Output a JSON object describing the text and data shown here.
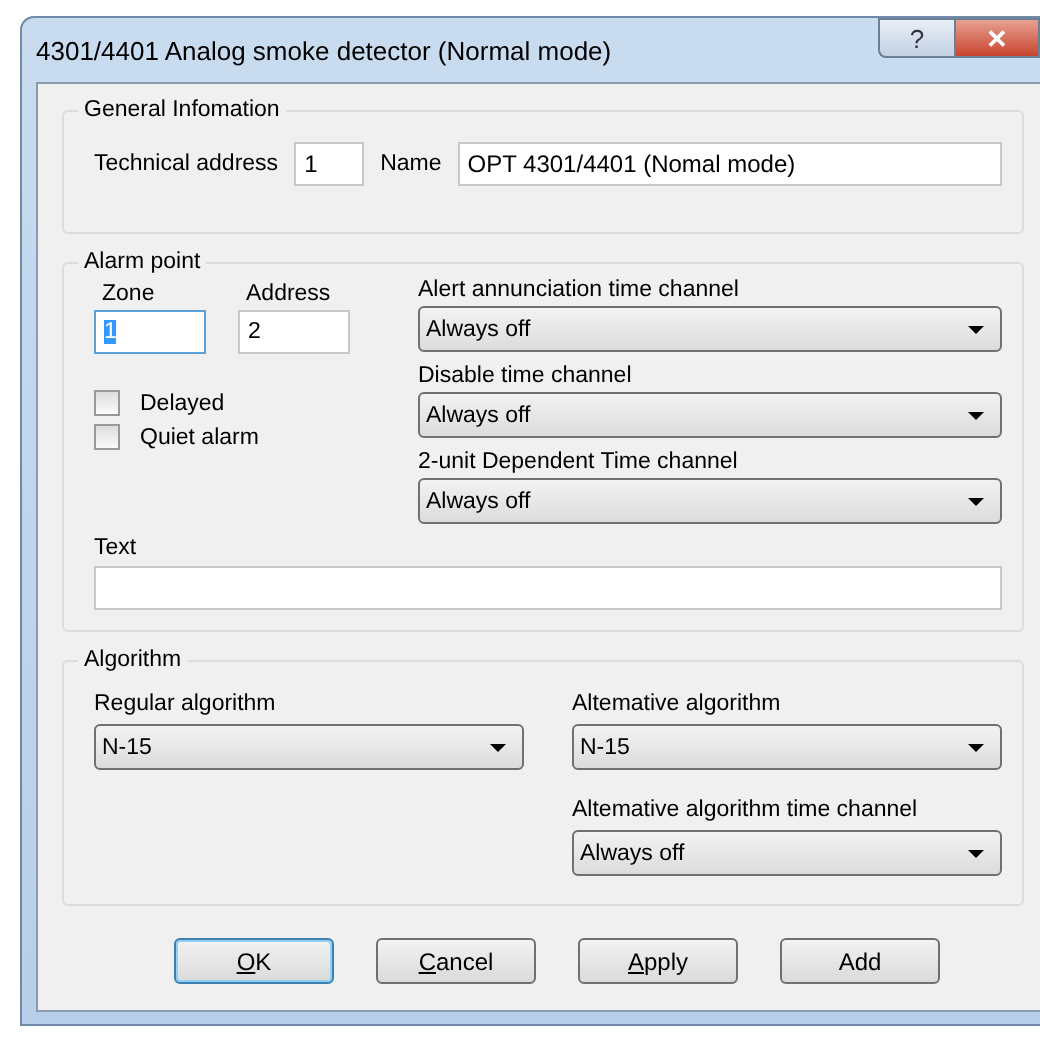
{
  "window": {
    "title": "4301/4401 Analog smoke detector (Normal mode)",
    "controls": [
      {
        "kind": "help",
        "label": "?"
      },
      {
        "kind": "close",
        "label": "✕"
      }
    ]
  },
  "general": {
    "title": "General Infomation",
    "technical_address": {
      "label": "Technical address",
      "value": "1"
    },
    "name": {
      "label": "Name",
      "value": "OPT 4301/4401 (Nomal mode)"
    }
  },
  "alarm_point": {
    "title": "Alarm point",
    "zone": {
      "label": "Zone",
      "value": "1",
      "focused": true
    },
    "address": {
      "label": "Address",
      "value": "2",
      "focused": false
    },
    "checkboxes": [
      {
        "label": "Delayed",
        "checked": false
      },
      {
        "label": "Quiet alarm",
        "checked": false
      }
    ],
    "channels": [
      {
        "label": "Alert annunciation time channel",
        "value": "Always off"
      },
      {
        "label": "Disable time channel",
        "value": "Always off"
      },
      {
        "label": "2-unit Dependent Time channel",
        "value": "Always off"
      }
    ],
    "text": {
      "label": "Text"
    }
  },
  "algorithm": {
    "title": "Algorithm",
    "regular": {
      "label": "Regular algorithm",
      "value": "N-15"
    },
    "alternative": {
      "label": "Altemative algorithm",
      "value": "N-15"
    },
    "alternative_time": {
      "label": "Altemative algorithm time channel",
      "value": "Always off"
    }
  },
  "buttons": [
    {
      "label": "OK",
      "default": true,
      "mnemonic": true
    },
    {
      "label": "Cancel",
      "default": false,
      "mnemonic": true
    },
    {
      "label": "Apply",
      "default": false,
      "mnemonic": true
    },
    {
      "label": "Add",
      "default": false,
      "mnemonic": false
    }
  ]
}
